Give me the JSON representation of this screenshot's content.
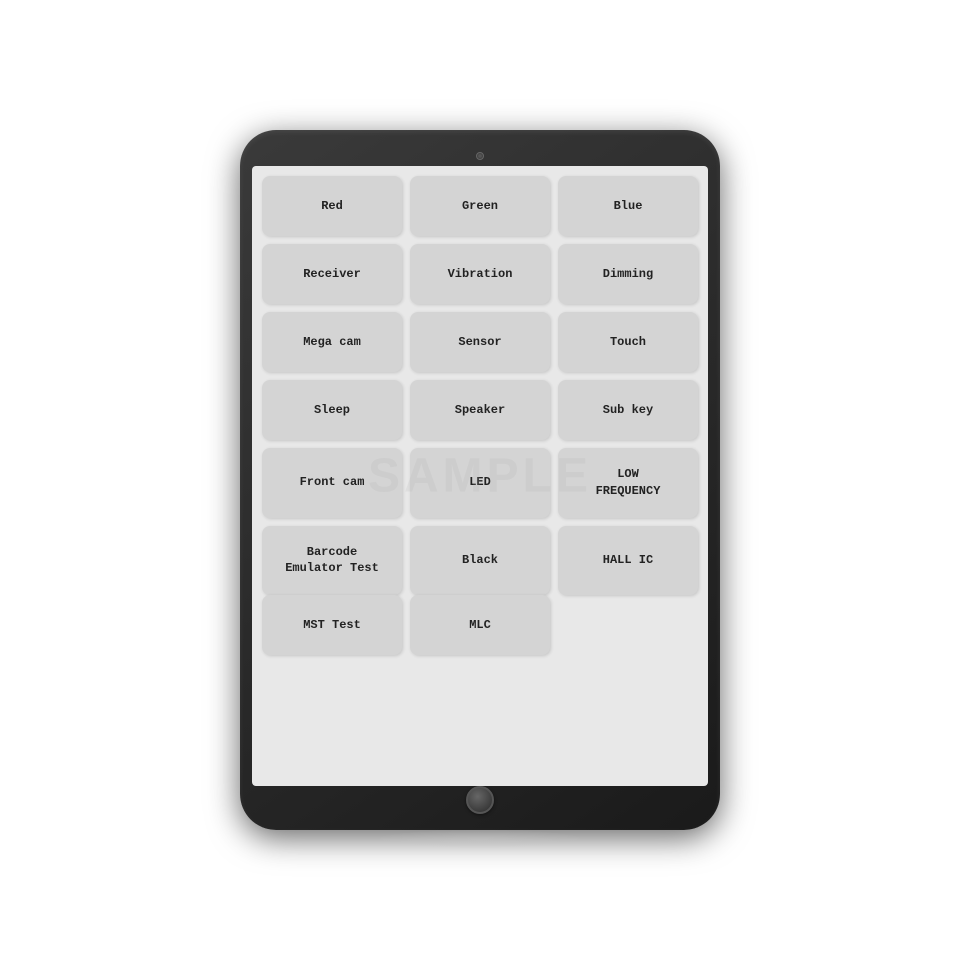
{
  "tablet": {
    "camera_label": "camera",
    "home_button_label": "home"
  },
  "buttons": {
    "rows": [
      [
        {
          "label": "Red",
          "id": "btn-red"
        },
        {
          "label": "Green",
          "id": "btn-green"
        },
        {
          "label": "Blue",
          "id": "btn-blue"
        }
      ],
      [
        {
          "label": "Receiver",
          "id": "btn-receiver"
        },
        {
          "label": "Vibration",
          "id": "btn-vibration"
        },
        {
          "label": "Dimming",
          "id": "btn-dimming"
        }
      ],
      [
        {
          "label": "Mega cam",
          "id": "btn-mega-cam"
        },
        {
          "label": "Sensor",
          "id": "btn-sensor"
        },
        {
          "label": "Touch",
          "id": "btn-touch"
        }
      ],
      [
        {
          "label": "Sleep",
          "id": "btn-sleep"
        },
        {
          "label": "Speaker",
          "id": "btn-speaker"
        },
        {
          "label": "Sub key",
          "id": "btn-sub-key"
        }
      ],
      [
        {
          "label": "Front cam",
          "id": "btn-front-cam"
        },
        {
          "label": "LED",
          "id": "btn-led"
        },
        {
          "label": "LOW\nFREQUENCY",
          "id": "btn-low-frequency"
        }
      ],
      [
        {
          "label": "Barcode\nEmulator Test",
          "id": "btn-barcode"
        },
        {
          "label": "Black",
          "id": "btn-black"
        },
        {
          "label": "HALL IC",
          "id": "btn-hall-ic"
        }
      ]
    ],
    "last_row": [
      {
        "label": "MST Test",
        "id": "btn-mst-test"
      },
      {
        "label": "MLC",
        "id": "btn-mlc"
      }
    ]
  },
  "watermark": {
    "text": "SAMPLE"
  }
}
